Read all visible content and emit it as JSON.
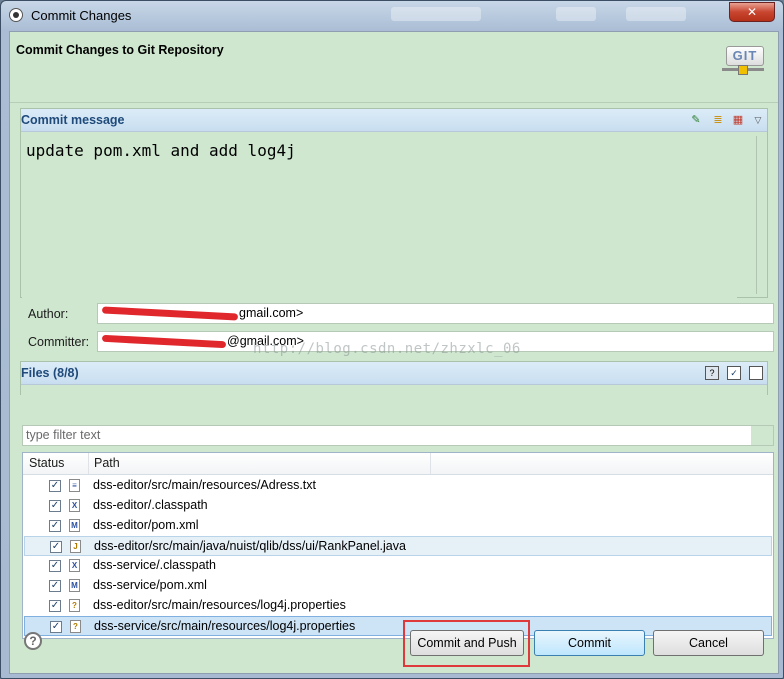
{
  "window": {
    "title": "Commit Changes",
    "close_label": "✕"
  },
  "header": {
    "heading": "Commit Changes to Git Repository",
    "logo_text": "GIT"
  },
  "commit_message": {
    "section_title": "Commit message",
    "text": "update pom.xml and add log4j",
    "toolbar_icons": [
      "add-signed-off-icon",
      "amend-icon",
      "compute-changeid-icon",
      "menu-dropdown-icon"
    ]
  },
  "author": {
    "label": "Author:",
    "value_suffix": "gmail.com>"
  },
  "committer": {
    "label": "Committer:",
    "value_suffix": "@gmail.com>"
  },
  "watermark": "http://blog.csdn.net/zhzxlc_06",
  "files": {
    "section_title": "Files (8/8)",
    "filter_placeholder": "type filter text",
    "columns": [
      "Status",
      "Path"
    ],
    "rows": [
      {
        "checked": true,
        "icon": "text-file-icon",
        "glyph": "≡",
        "path": "dss-editor/src/main/resources/Adress.txt"
      },
      {
        "checked": true,
        "icon": "xml-file-icon",
        "glyph": "X",
        "path": "dss-editor/.classpath"
      },
      {
        "checked": true,
        "icon": "maven-file-icon",
        "glyph": "M",
        "path": "dss-editor/pom.xml"
      },
      {
        "checked": true,
        "icon": "java-file-icon",
        "glyph": "J",
        "path": "dss-editor/src/main/java/nuist/qlib/dss/ui/RankPanel.java"
      },
      {
        "checked": true,
        "icon": "xml-file-icon",
        "glyph": "X",
        "path": "dss-service/.classpath"
      },
      {
        "checked": true,
        "icon": "maven-file-icon",
        "glyph": "M",
        "path": "dss-service/pom.xml"
      },
      {
        "checked": true,
        "icon": "properties-file-icon",
        "glyph": "?",
        "path": "dss-editor/src/main/resources/log4j.properties"
      },
      {
        "checked": true,
        "icon": "properties-file-icon",
        "glyph": "?",
        "path": "dss-service/src/main/resources/log4j.properties"
      }
    ]
  },
  "buttons": {
    "help": "?",
    "commit_and_push": "Commit and Push",
    "commit": "Commit",
    "cancel": "Cancel"
  },
  "colors": {
    "panel_bg": "#cfe7cf",
    "section_title": "#1f4a7a",
    "highlight_box": "#e0393b",
    "redaction": "#e0282c"
  }
}
